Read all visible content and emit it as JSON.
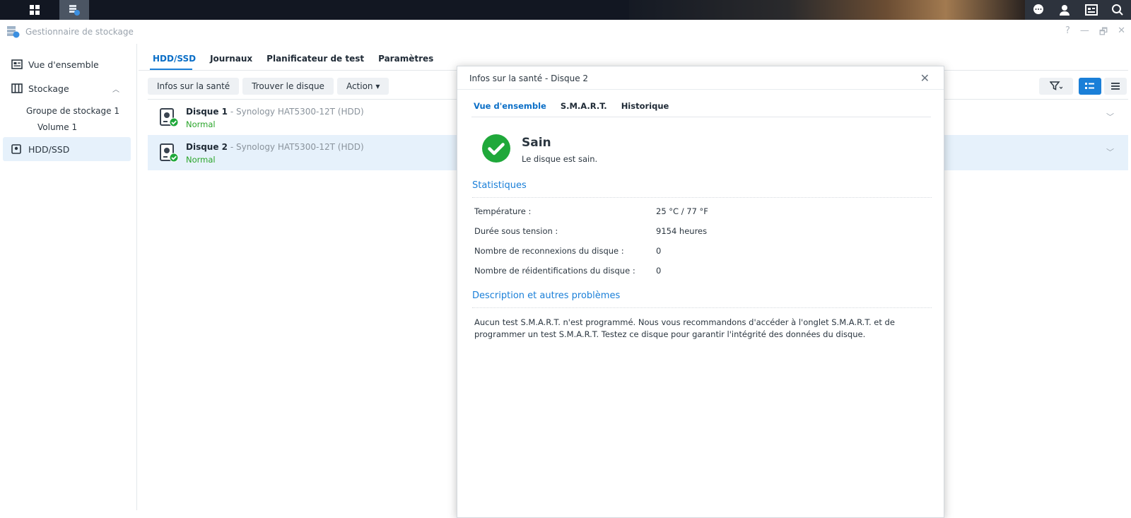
{
  "window": {
    "title": "Gestionnaire de stockage",
    "controls": [
      "?",
      "—",
      "🗗",
      "✕"
    ]
  },
  "sidebar": {
    "items": [
      {
        "label": "Vue d'ensemble"
      },
      {
        "label": "Stockage"
      },
      {
        "label": "Groupe de stockage 1"
      },
      {
        "label": "Volume 1"
      },
      {
        "label": "HDD/SSD"
      }
    ]
  },
  "tabs": [
    "HDD/SSD",
    "Journaux",
    "Planificateur de test",
    "Paramètres"
  ],
  "toolbar": {
    "health": "Infos sur la santé",
    "find": "Trouver le disque",
    "action": "Action ▾"
  },
  "disks": [
    {
      "name": "Disque 1",
      "model": " - Synology HAT5300-12T (HDD)",
      "status": "Normal"
    },
    {
      "name": "Disque 2",
      "model": " - Synology HAT5300-12T (HDD)",
      "status": "Normal"
    }
  ],
  "dialog": {
    "title": "Infos sur la santé - Disque 2",
    "tabs": [
      "Vue d'ensemble",
      "S.M.A.R.T.",
      "Historique"
    ],
    "health_title": "Sain",
    "health_sub": "Le disque est sain.",
    "stats_heading": "Statistiques",
    "stats": [
      {
        "label": "Température :",
        "value": "25 °C / 77 °F"
      },
      {
        "label": "Durée sous tension :",
        "value": "9154 heures"
      },
      {
        "label": "Nombre de reconnexions du disque :",
        "value": "0"
      },
      {
        "label": "Nombre de réidentifications du disque :",
        "value": "0"
      }
    ],
    "desc_heading": "Description et autres problèmes",
    "desc": "Aucun test S.M.A.R.T. n'est programmé. Nous vous recommandons d'accéder à l'onglet S.M.A.R.T. et de programmer un test S.M.A.R.T. Testez ce disque pour garantir l'intégrité des données du disque."
  },
  "colors": {
    "accent": "#1a7fd8",
    "ok": "#1fa83a",
    "selected": "#e6f1fb"
  }
}
